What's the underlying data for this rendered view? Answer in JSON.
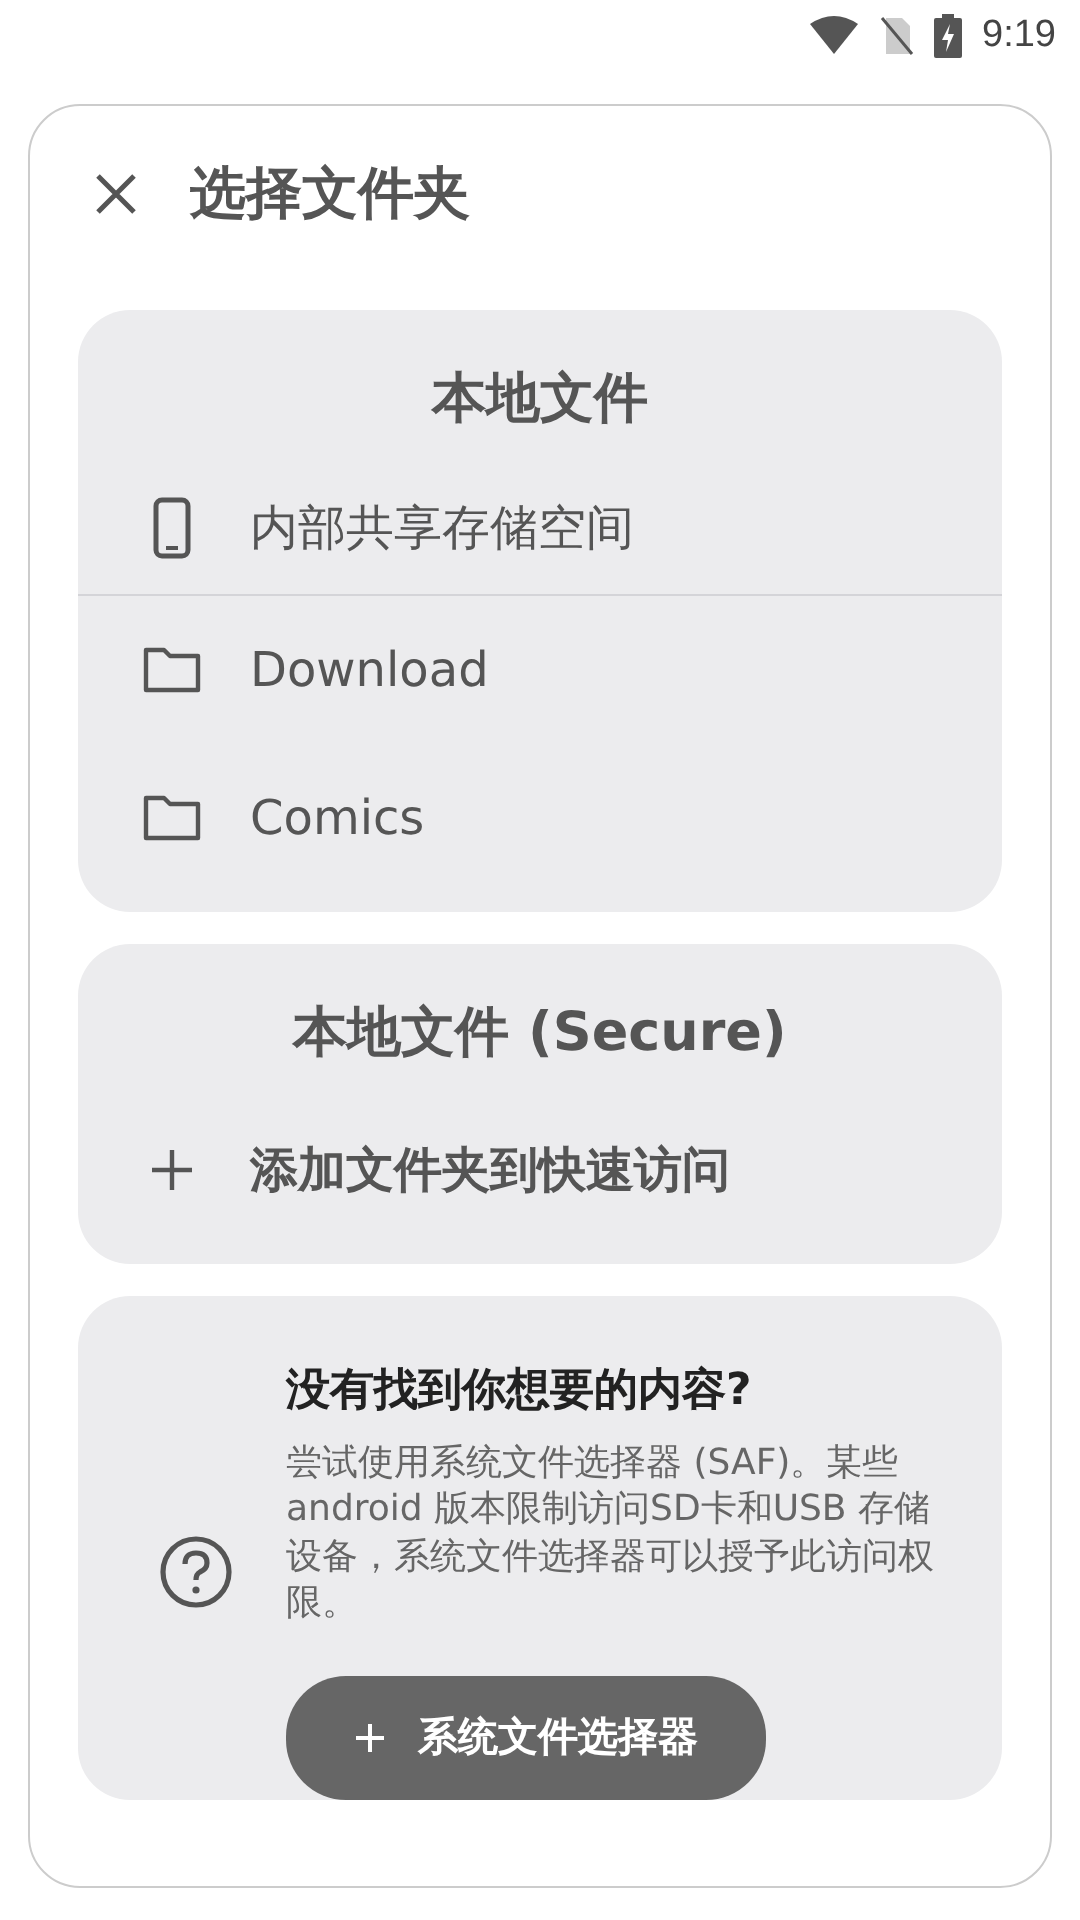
{
  "status_bar": {
    "time": "9:19"
  },
  "dialog": {
    "title": "选择文件夹"
  },
  "sections": [
    {
      "title": "本地文件",
      "items": [
        {
          "kind": "device",
          "label": "内部共享存储空间"
        },
        {
          "kind": "folder",
          "label": "Download"
        },
        {
          "kind": "folder",
          "label": "Comics"
        }
      ]
    },
    {
      "title": "本地文件 (Secure)",
      "items": [
        {
          "kind": "add",
          "label": "添加文件夹到快速访问"
        }
      ]
    }
  ],
  "help": {
    "title": "没有找到你想要的内容?",
    "body": "尝试使用系统文件选择器 (SAF)。某些android 版本限制访问SD卡和USB 存储设备，系统文件选择器可以授予此访问权限。",
    "button": "系统文件选择器"
  }
}
